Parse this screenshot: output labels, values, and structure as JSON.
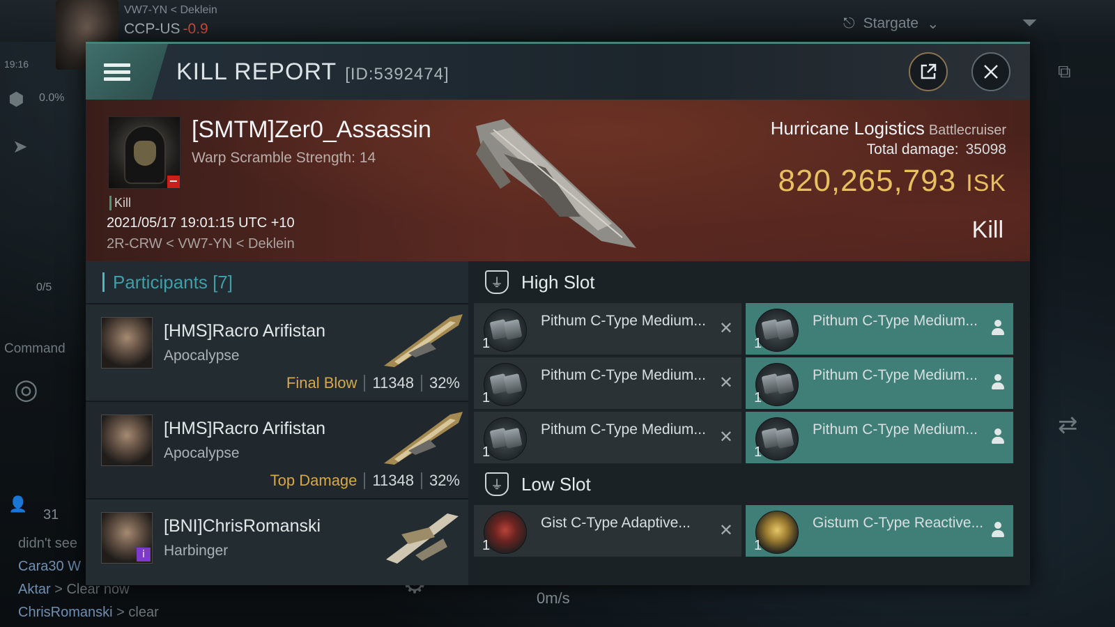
{
  "hud": {
    "location": "VW7-YN  < Deklein",
    "server": "CCP-US",
    "security": "-0.9",
    "time": "19:16",
    "cargo_percent": "0.0%",
    "command_label": "Command",
    "fleet_fraction": "0/5",
    "local_count": "31",
    "speed": "0m/s",
    "stargate_label": "Stargate"
  },
  "chat": [
    {
      "who": "",
      "text": "didn't see"
    },
    {
      "who": "Cara30 W",
      "text": ""
    },
    {
      "who": "Aktar",
      "text": " > Clear now"
    },
    {
      "who": "ChrisRomanski",
      "text": " > clear"
    }
  ],
  "window": {
    "title": "KILL REPORT",
    "report_id": "[ID:5392474]"
  },
  "victim": {
    "name": "[SMTM]Zer0_Assassin",
    "warp_scramble": "Warp Scramble Strength: 14",
    "kill_tag": "Kill",
    "timestamp": "2021/05/17 19:01:15 UTC +10",
    "location": "2R-CRW < VW7-YN < Deklein",
    "ship_name": "Hurricane Logistics",
    "ship_class": "Battlecruiser",
    "total_damage_label": "Total damage:",
    "total_damage": "35098",
    "isk_value": "820,265,793",
    "isk_unit": "ISK",
    "result": "Kill"
  },
  "participants": {
    "header": "Participants [7]",
    "rows": [
      {
        "name": "[HMS]Racro Arifistan",
        "ship": "Apocalypse",
        "role": "Final Blow",
        "damage": "11348",
        "percent": "32%"
      },
      {
        "name": "[HMS]Racro Arifistan",
        "ship": "Apocalypse",
        "role": "Top Damage",
        "damage": "11348",
        "percent": "32%"
      },
      {
        "name": "[BNI]ChrisRomanski",
        "ship": "Harbinger",
        "role": "",
        "damage": "",
        "percent": ""
      }
    ]
  },
  "fitting": {
    "high_slot_label": "High Slot",
    "low_slot_label": "Low Slot",
    "high_slots": [
      {
        "name": "Pithum C-Type Medium...",
        "qty": "1",
        "state": "destroyed",
        "icon": "launcher-icon"
      },
      {
        "name": "Pithum C-Type Medium...",
        "qty": "1",
        "state": "dropped",
        "icon": "launcher-icon"
      },
      {
        "name": "Pithum C-Type Medium...",
        "qty": "1",
        "state": "destroyed",
        "icon": "launcher-icon"
      },
      {
        "name": "Pithum C-Type Medium...",
        "qty": "1",
        "state": "dropped",
        "icon": "launcher-icon"
      },
      {
        "name": "Pithum C-Type Medium...",
        "qty": "1",
        "state": "destroyed",
        "icon": "launcher-icon"
      },
      {
        "name": "Pithum C-Type Medium...",
        "qty": "1",
        "state": "dropped",
        "icon": "launcher-icon"
      }
    ],
    "low_slots": [
      {
        "name": "Gist C-Type Adaptive...",
        "qty": "1",
        "state": "destroyed",
        "icon": "armor-red-icon"
      },
      {
        "name": "Gistum C-Type Reactive...",
        "qty": "1",
        "state": "dropped",
        "icon": "armor-gold-icon"
      }
    ]
  },
  "colors": {
    "accent_teal": "#3f7f78",
    "isk_gold": "#e8c060",
    "role_gold": "#d8a845",
    "security_red": "#d34c3c"
  }
}
